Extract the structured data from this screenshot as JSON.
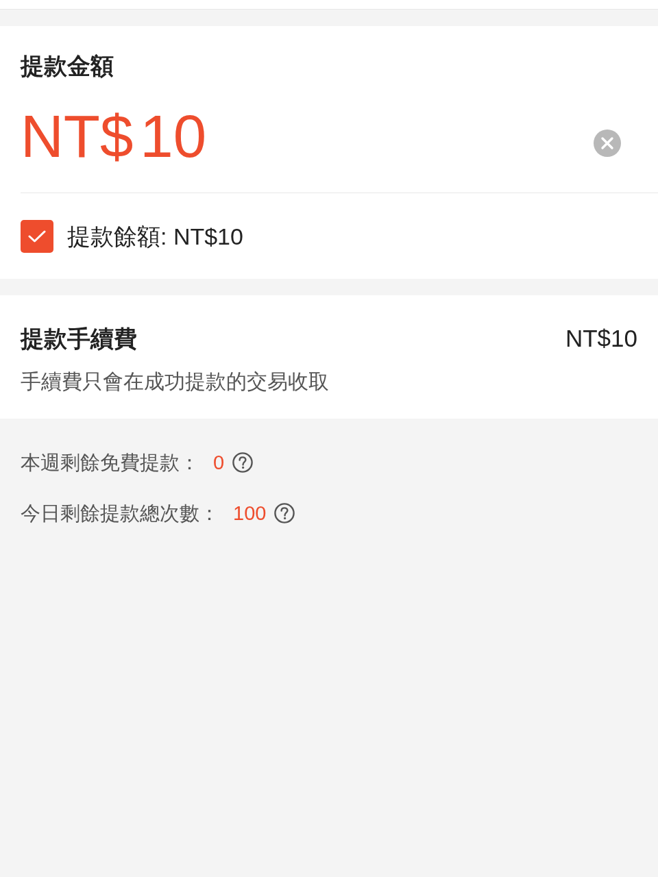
{
  "amount_section": {
    "title": "提款金額",
    "currency": "NT$",
    "value": "10"
  },
  "use_balance": {
    "label": "提款餘額: NT$10",
    "checked": true
  },
  "fee": {
    "title": "提款手續費",
    "amount": "NT$10",
    "note": "手續費只會在成功提款的交易收取"
  },
  "limits": [
    {
      "label": "本週剩餘免費提款：",
      "value": "0"
    },
    {
      "label": "今日剩餘提款總次數：",
      "value": "100"
    }
  ]
}
